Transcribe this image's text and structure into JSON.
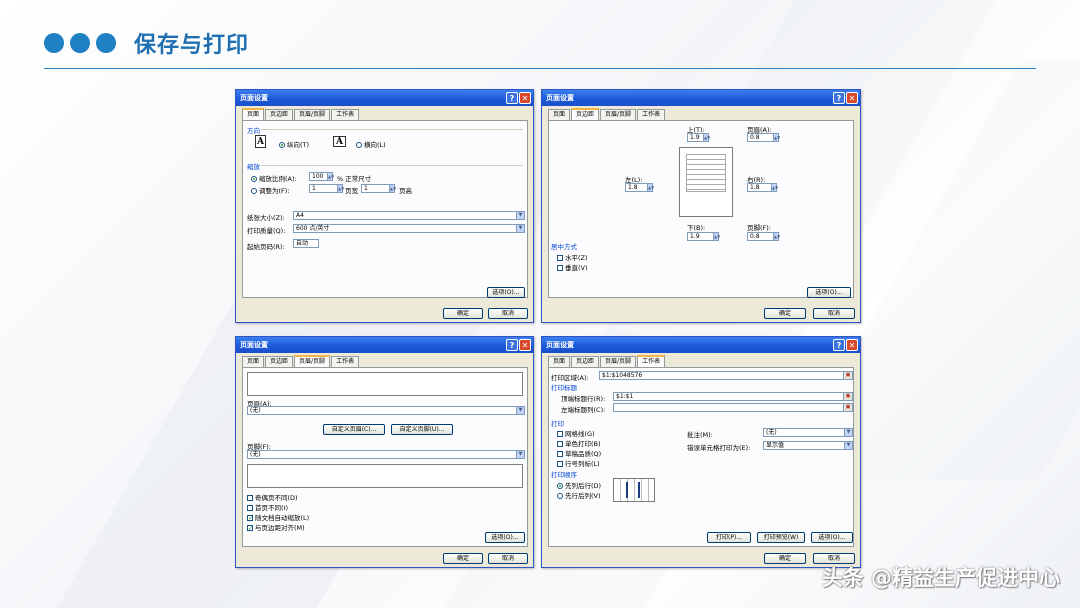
{
  "slide": {
    "title": "保存与打印",
    "watermark": "头条 @精益生产促进中心"
  },
  "dialog_common": {
    "title": "页面设置",
    "help_glyph": "?",
    "close_glyph": "✕",
    "tabs": [
      "页面",
      "页边距",
      "页眉/页脚",
      "工作表"
    ],
    "options_btn": "选项(O)...",
    "ok_btn": "确定",
    "cancel_btn": "取消"
  },
  "page_tab": {
    "orientation_group": "方向",
    "portrait": "纵向(T)",
    "landscape": "横向(L)",
    "icon_letter": "A",
    "scale_group": "缩放",
    "scale_label": "缩放比例(A):",
    "scale_value": "100",
    "scale_suffix": "% 正常尺寸",
    "fit_label": "调整为(F):",
    "fit_wide": "1",
    "fit_wide_suffix": "页宽",
    "fit_tall": "1",
    "fit_tall_suffix": "页高",
    "paper_label": "纸张大小(Z):",
    "paper_value": "A4",
    "quality_label": "打印质量(Q):",
    "quality_value": "600 点/英寸",
    "first_page_label": "起始页码(R):",
    "first_page_value": "自动"
  },
  "margins_tab": {
    "top_label": "上(T):",
    "top_value": "1.9",
    "header_label": "页眉(A):",
    "header_value": "0.8",
    "left_label": "左(L):",
    "left_value": "1.8",
    "right_label": "右(R):",
    "right_value": "1.8",
    "bottom_label": "下(B):",
    "bottom_value": "1.9",
    "footer_label": "页脚(F):",
    "footer_value": "0.8",
    "center_group": "居中方式",
    "horizontal": "水平(Z)",
    "vertical": "垂直(V)"
  },
  "headerfooter_tab": {
    "header_label": "页眉(A):",
    "header_value": "(无)",
    "custom_header_btn": "自定义页眉(C)...",
    "custom_footer_btn": "自定义页脚(U)...",
    "footer_label": "页脚(F):",
    "footer_value": "(无)",
    "odd_even": "奇偶页不同(D)",
    "first_diff": "首页不同(I)",
    "scale_with_doc": "随文档自动缩放(L)",
    "align_margins": "与页边距对齐(M)",
    "check_glyph": "✓"
  },
  "sheet_tab": {
    "print_area_label": "打印区域(A):",
    "print_area_value": "$1:$1048576",
    "print_titles_group": "打印标题",
    "rows_repeat_label": "顶端标题行(R):",
    "rows_repeat_value": "$1:$1",
    "cols_repeat_label": "左端标题列(C):",
    "cols_repeat_value": "",
    "print_group": "打印",
    "gridlines": "网格线(G)",
    "black_white": "单色打印(B)",
    "draft": "草稿品质(Q)",
    "row_col_headings": "行号列标(L)",
    "comments_label": "批注(M):",
    "comments_value": "(无)",
    "errors_label": "错误单元格打印为(E):",
    "errors_value": "显示值",
    "page_order_group": "打印顺序",
    "down_then_over": "先列后行(D)",
    "over_then_down": "先行后列(V)",
    "print_btn": "打印(P)...",
    "preview_btn": "打印预览(W)",
    "options_btn": "选项(O)..."
  }
}
